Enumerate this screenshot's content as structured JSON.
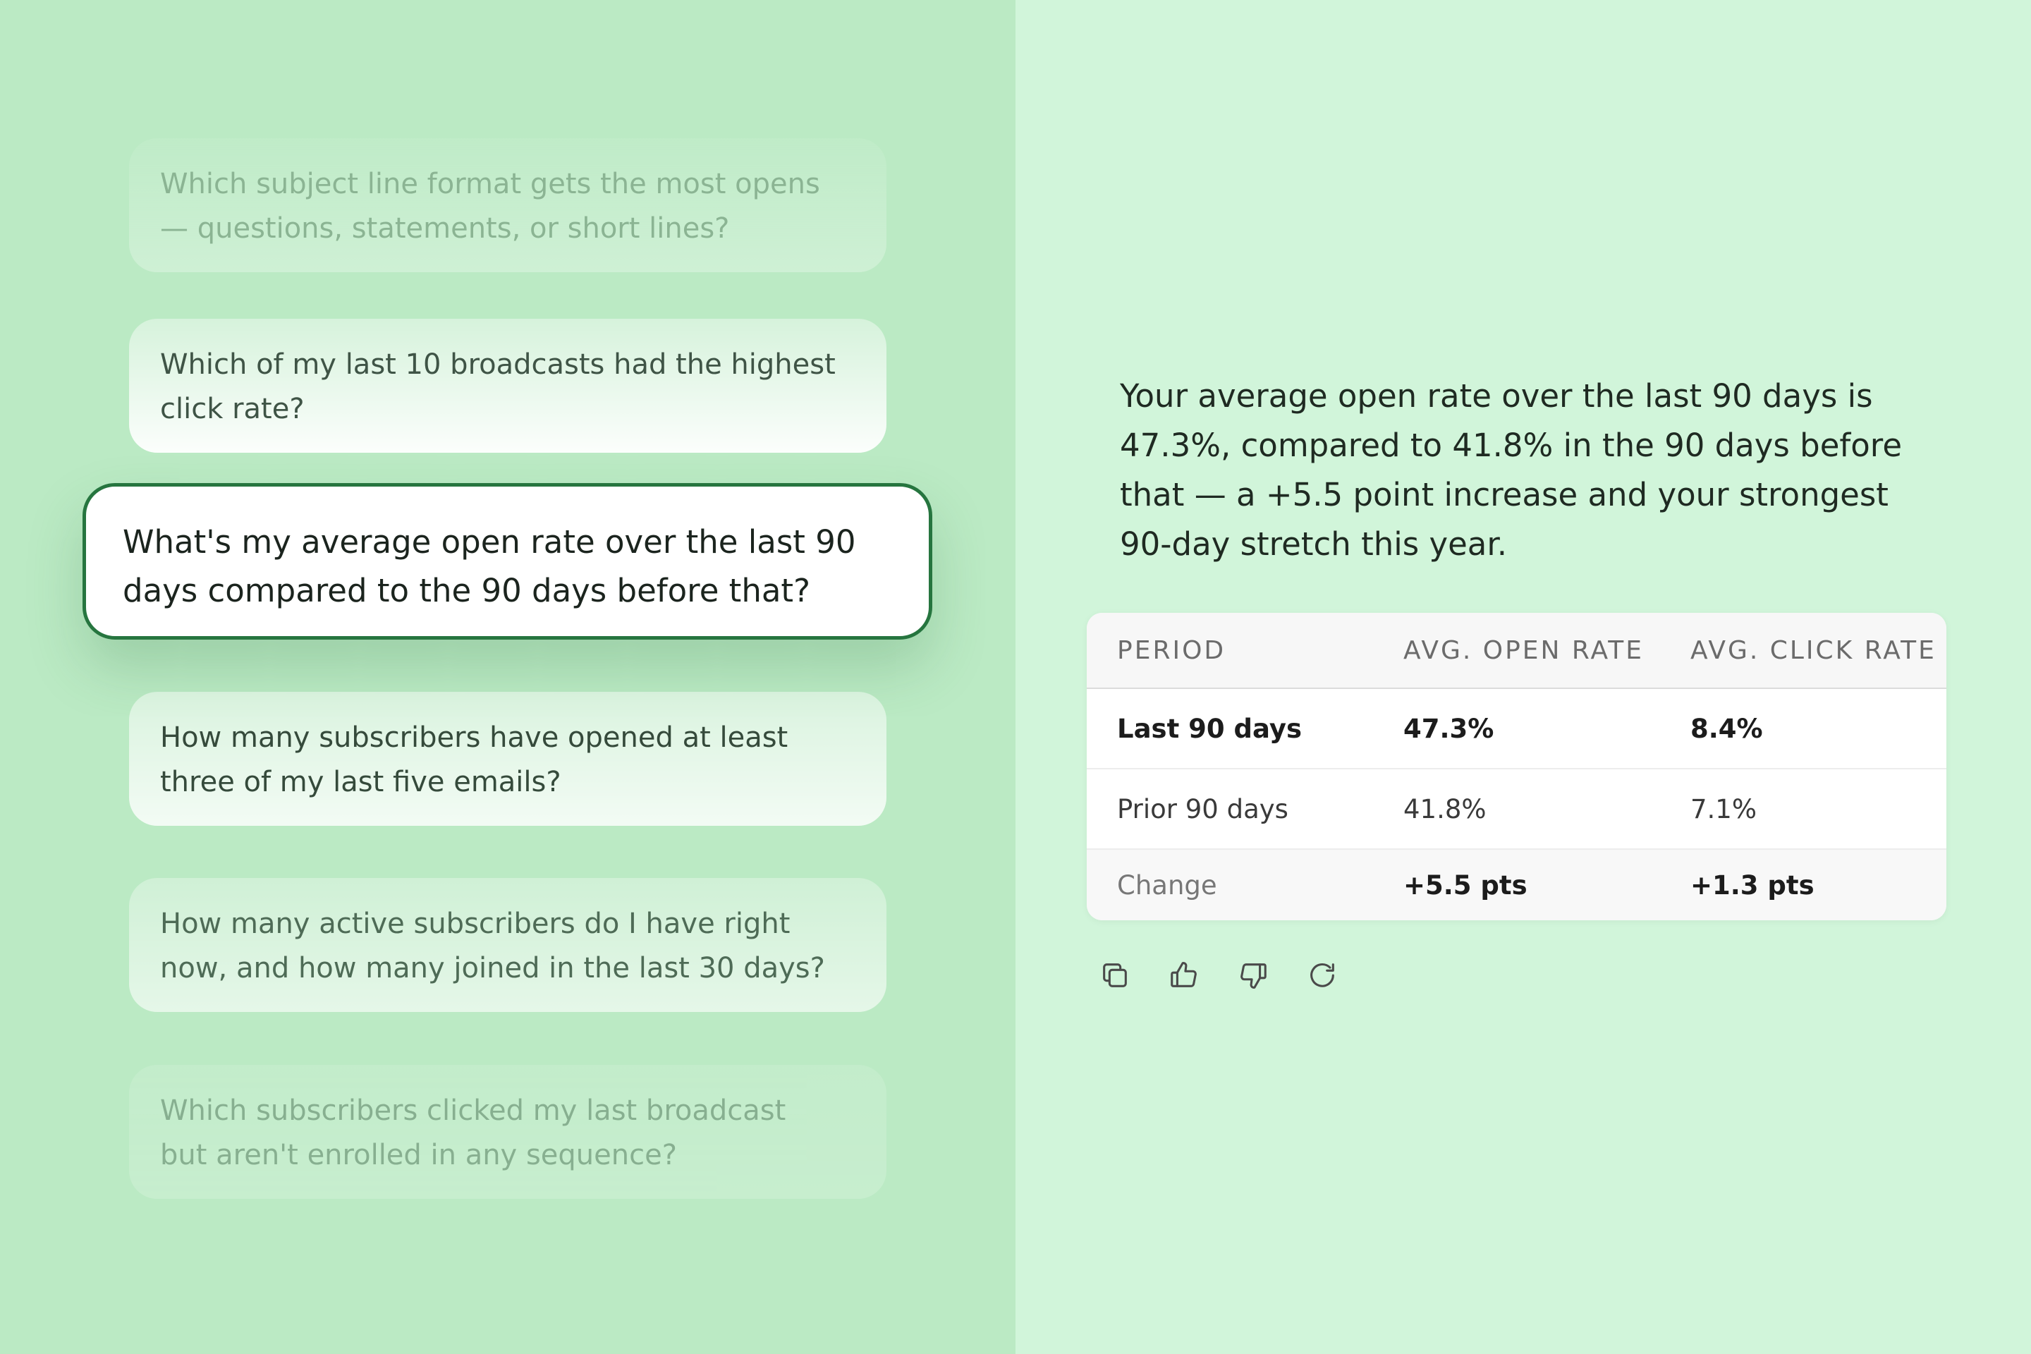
{
  "suggestions": [
    {
      "line1": "Which subject line format gets the most opens",
      "line2": "— questions, statements, or short lines?"
    },
    {
      "line1": "Which of my last 10 broadcasts had the highest",
      "line2": "click rate?"
    },
    {
      "line1": "What's my average open rate over the last 90",
      "line2": "days compared to the 90 days before that?"
    },
    {
      "line1": "How many subscribers have opened at least",
      "line2": "three of my last five emails?"
    },
    {
      "line1": "How many active subscribers do I have right",
      "line2": "now, and how many joined in the last 30 days?"
    },
    {
      "line1": "Which subscribers clicked my last broadcast",
      "line2": "but aren't enrolled in any sequence?"
    }
  ],
  "answer": {
    "lines": [
      "Your average open rate over the last 90 days is",
      "47.3%, compared to 41.8% in the 90 days before",
      "that — a +5.5 point increase and your strongest",
      "90-day stretch this year."
    ]
  },
  "table": {
    "headers": [
      "PERIOD",
      "AVG. OPEN RATE",
      "AVG. CLICK RATE"
    ],
    "rows": [
      [
        "Last 90 days",
        "47.3%",
        "8.4%"
      ],
      [
        "Prior 90 days",
        "41.8%",
        "7.1%"
      ],
      [
        "Change",
        "+5.5 pts",
        "+1.3 pts"
      ]
    ]
  },
  "actions": {
    "icons": [
      "copy-icon",
      "thumbs-up-icon",
      "thumbs-down-icon",
      "refresh-icon"
    ]
  },
  "colors": {
    "left_bg": "#bbeac4",
    "right_bg": "#d1f5da",
    "accent": "#26753f"
  }
}
